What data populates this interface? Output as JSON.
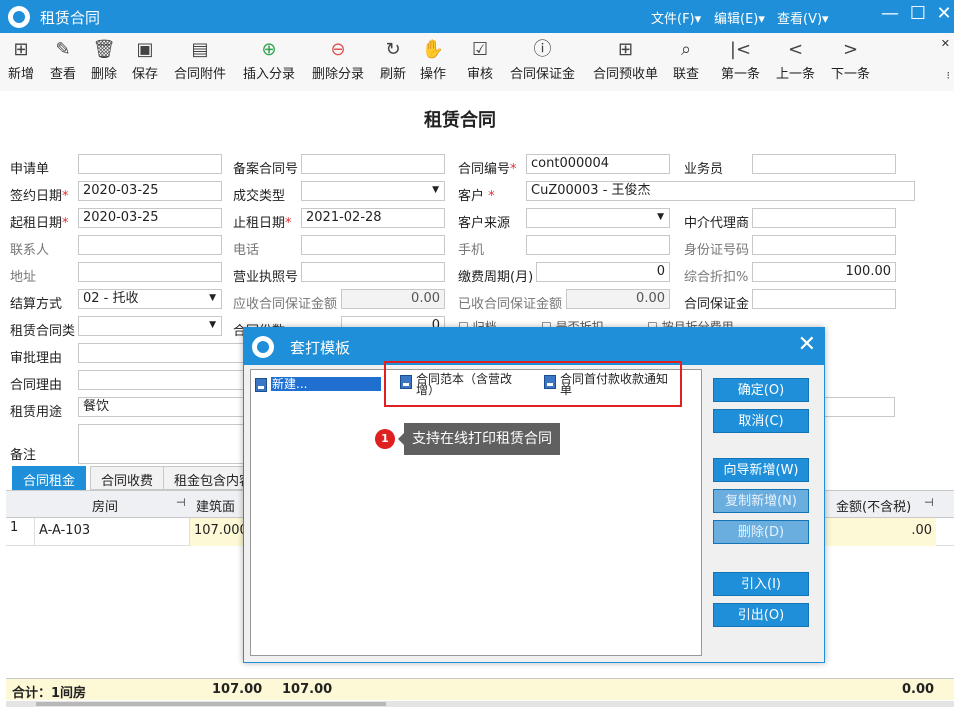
{
  "window": {
    "title": "租赁合同",
    "menus": [
      "文件(F)▾",
      "编辑(E)▾",
      "查看(V)▾"
    ],
    "controls": {
      "minimize": "—",
      "maximize": "☐",
      "close": "✕"
    }
  },
  "toolbar": {
    "buttons": [
      {
        "label": "新增",
        "icon": "⊞"
      },
      {
        "label": "查看",
        "icon": "✎"
      },
      {
        "label": "删除",
        "icon": "🗑"
      },
      {
        "label": "保存",
        "icon": "▣"
      },
      {
        "label": "合同附件",
        "icon": "▤"
      },
      {
        "label": "插入分录",
        "icon": "⊕"
      },
      {
        "label": "删除分录",
        "icon": "⊖"
      },
      {
        "label": "刷新",
        "icon": "↻"
      },
      {
        "label": "操作",
        "icon": "✋"
      },
      {
        "label": "审核",
        "icon": "☑"
      },
      {
        "label": "合同保证金",
        "icon": "ⓘ"
      },
      {
        "label": "合同预收单",
        "icon": "⊞"
      },
      {
        "label": "联查",
        "icon": "⌕"
      },
      {
        "label": "第一条",
        "icon": "|<"
      },
      {
        "label": "上一条",
        "icon": "<"
      },
      {
        "label": "下一条",
        "icon": ">"
      }
    ],
    "more_top": "✕",
    "more_bottom": "⁝"
  },
  "form": {
    "title": "租赁合同",
    "fields": {
      "application": {
        "label": "申请单",
        "value": ""
      },
      "filing_no": {
        "label": "备案合同号",
        "value": ""
      },
      "contract_no": {
        "label": "合同编号",
        "value": "cont000004"
      },
      "salesman": {
        "label": "业务员",
        "value": ""
      },
      "sign_date": {
        "label": "签约日期",
        "value": "2020-03-25"
      },
      "deal_type": {
        "label": "成交类型",
        "value": ""
      },
      "customer": {
        "label": "客户",
        "value": "CuZ00003 - 王俊杰"
      },
      "start_date": {
        "label": "起租日期",
        "value": "2020-03-25"
      },
      "end_date": {
        "label": "止租日期",
        "value": "2021-02-28"
      },
      "customer_source": {
        "label": "客户来源",
        "value": ""
      },
      "agent": {
        "label": "中介代理商",
        "value": ""
      },
      "contact": {
        "label": "联系人",
        "value": ""
      },
      "phone": {
        "label": "电话",
        "value": ""
      },
      "mobile": {
        "label": "手机",
        "value": ""
      },
      "id_no": {
        "label": "身份证号码",
        "value": ""
      },
      "address": {
        "label": "地址",
        "value": ""
      },
      "license": {
        "label": "营业执照号",
        "value": ""
      },
      "pay_cycle": {
        "label": "缴费周期(月)",
        "value": "0"
      },
      "discount": {
        "label": "综合折扣%",
        "value": "100.00"
      },
      "settlement": {
        "label": "结算方式",
        "value": "02 - 托收"
      },
      "deposit_due": {
        "label": "应收合同保证金额",
        "value": "0.00"
      },
      "deposit_received": {
        "label": "已收合同保证金额",
        "value": "0.00"
      },
      "deposit": {
        "label": "合同保证金",
        "value": ""
      },
      "contract_type": {
        "label": "租赁合同类",
        "value": ""
      },
      "contract_count": {
        "label": "合同份数",
        "value": "0"
      },
      "approval_reason": {
        "label": "审批理由",
        "value": ""
      },
      "contract_reason": {
        "label": "合同理由",
        "value": ""
      },
      "usage": {
        "label": "租赁用途",
        "value": "餐饮"
      },
      "remark": {
        "label": "备注",
        "value": ""
      }
    },
    "checkboxes": [
      "☐ 归档",
      "☐ 是否折扣",
      "☐ 按月折分费用"
    ]
  },
  "tabs": [
    "合同租金",
    "合同收费",
    "租金包含内容"
  ],
  "grid": {
    "headers": {
      "room": "房间",
      "area": "建筑面",
      "amount": "金额(不含税)"
    },
    "pin": "⊣",
    "rows": [
      {
        "index": "1",
        "room": "A-A-103",
        "area": "107.000",
        "amount": ".00"
      }
    ],
    "footer": {
      "label": "合计：1间房",
      "area1": "107.00",
      "area2": "107.00",
      "amount": "0.00"
    }
  },
  "dialog": {
    "title": "套打模板",
    "close": "✕",
    "items": [
      {
        "label": "新建..."
      },
      {
        "label": "合同范本（含营改增）"
      },
      {
        "label": "合同首付款收款通知单"
      }
    ],
    "buttons": {
      "ok": "确定(O)",
      "cancel": "取消(C)",
      "wizard_new": "向导新增(W)",
      "copy_new": "复制新增(N)",
      "delete": "删除(D)",
      "import": "引入(I)",
      "export": "引出(O)"
    }
  },
  "callout": {
    "number": "1",
    "text": "支持在线打印租赁合同"
  }
}
